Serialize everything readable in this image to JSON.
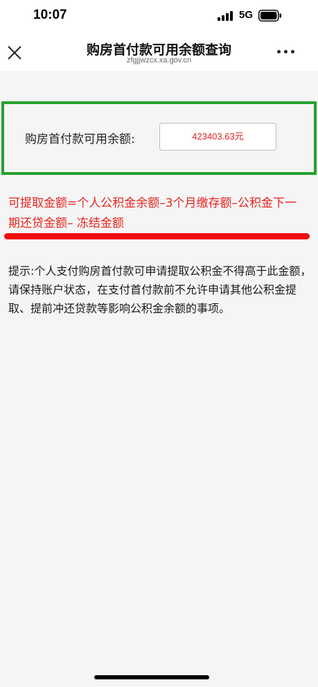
{
  "status_bar": {
    "time": "10:07",
    "network": "5G"
  },
  "nav": {
    "title": "购房首付款可用余额查询",
    "url": "zfgjjwzcx.xa.gov.cn"
  },
  "balance": {
    "label": "购房首付款可用余额:",
    "value": "423403.63元"
  },
  "formula": {
    "text": "可提取金额=个人公积金余额–3个月缴存额–公积金下一期还贷金额– 冻结金额"
  },
  "tip": {
    "text": "提示:个人支付购房首付款可申请提取公积金不得高于此金额，请保持账户状态，在支付首付款前不允许申请其他公积金提取、提前冲还贷款等影响公积金余额的事项。"
  },
  "colors": {
    "highlight_box": "#25a12c",
    "formula_text": "#e8231e",
    "value_text": "#e02020",
    "underline": "#f10d0d"
  }
}
